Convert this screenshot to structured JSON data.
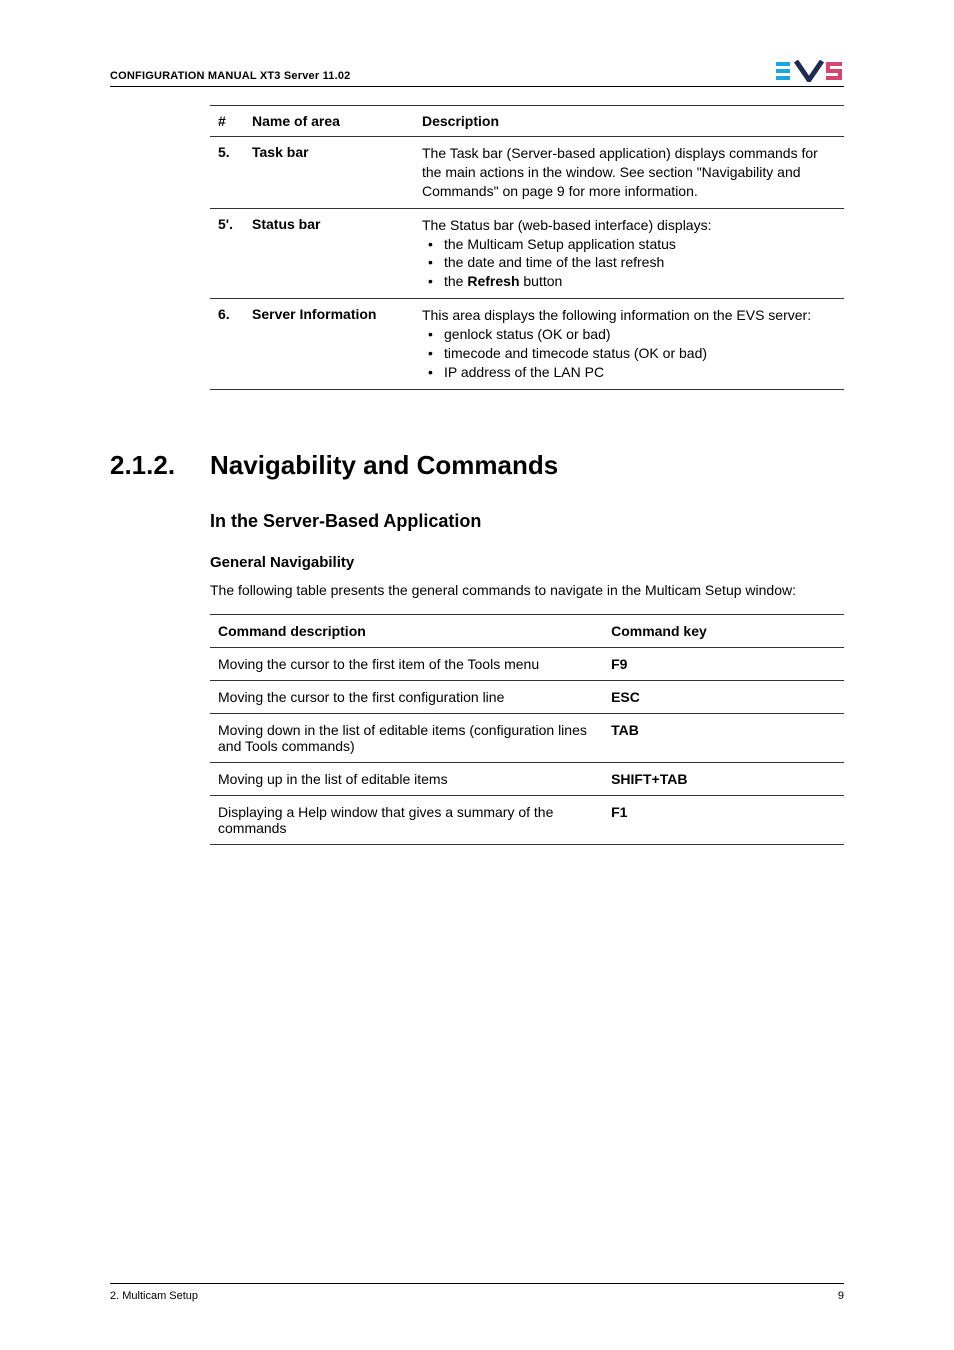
{
  "header": {
    "title": "CONFIGURATION MANUAL  XT3 Server 11.02"
  },
  "table1": {
    "headers": {
      "num": "#",
      "name": "Name of area",
      "desc": "Description"
    },
    "rows": [
      {
        "num": "5.",
        "name": "Task bar",
        "desc_text": "The Task bar (Server-based application) displays commands for the main actions in the window. See section \"Navigability and Commands\" on page 9 for more information.",
        "bullets": []
      },
      {
        "num": "5'.",
        "name": "Status bar",
        "desc_text": "The Status bar (web-based interface) displays:",
        "bullets": [
          "the Multicam Setup application status",
          "the date and time of the last refresh",
          "the Refresh button"
        ],
        "bold_in_last": "Refresh"
      },
      {
        "num": "6.",
        "name": "Server Information",
        "desc_text": "This area displays the following information on the EVS server:",
        "bullets": [
          "genlock status (OK or bad)",
          "timecode and timecode status (OK or bad)",
          "IP address of the LAN PC"
        ]
      }
    ]
  },
  "section": {
    "num": "2.1.2.",
    "title": "Navigability and Commands",
    "h2": "In the Server-Based Application",
    "h3": "General Navigability",
    "para": "The following table presents the general commands to navigate in the Multicam Setup window:"
  },
  "table2": {
    "headers": {
      "desc": "Command description",
      "key": "Command key"
    },
    "rows": [
      {
        "desc": "Moving the cursor to the first item of the Tools menu",
        "key": "F9"
      },
      {
        "desc": "Moving the cursor to the first configuration line",
        "key": "ESC"
      },
      {
        "desc": "Moving down in the list of editable items (configuration lines and Tools commands)",
        "key": "TAB"
      },
      {
        "desc": "Moving up in the list of editable items",
        "key": "SHIFT+TAB"
      },
      {
        "desc": "Displaying a Help window that gives a summary of the commands",
        "key": "F1"
      }
    ]
  },
  "footer": {
    "left": "2. Multicam Setup",
    "right": "9"
  }
}
